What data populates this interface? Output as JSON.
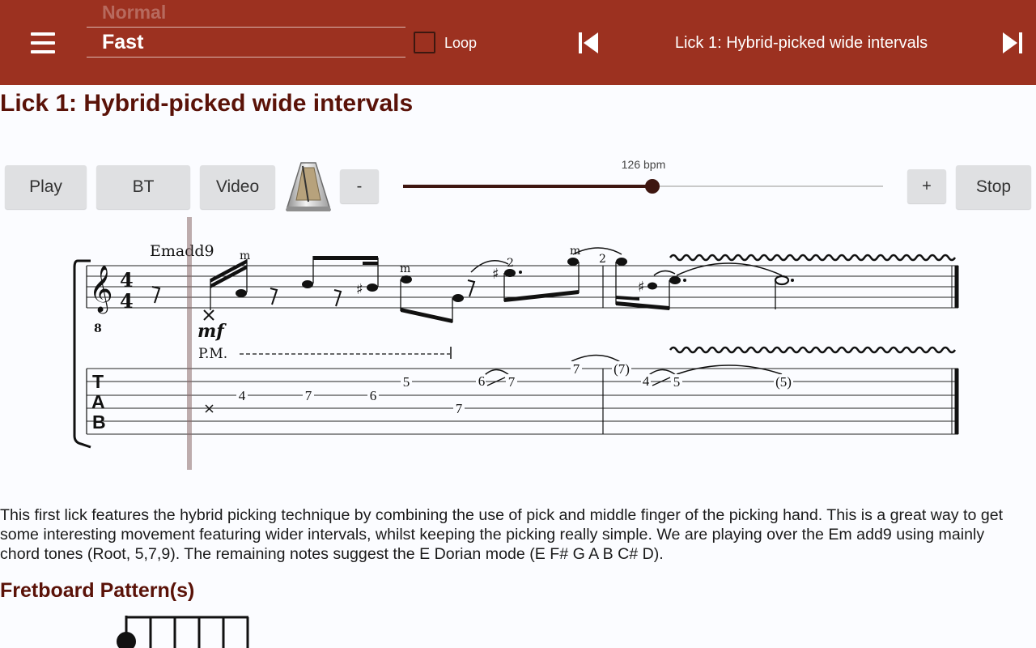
{
  "header": {
    "speed_prev": "Normal",
    "speed_current": "Fast",
    "loop_label": "Loop",
    "loop_checked": false,
    "title": "Lick 1: Hybrid-picked wide intervals",
    "icons": {
      "menu": "hamburger-menu-icon",
      "prev": "skip-previous-icon",
      "next": "skip-next-icon"
    },
    "colors": {
      "bar_bg": "#9c3120",
      "heading": "#5a1208"
    }
  },
  "page": {
    "title": "Lick 1: Hybrid-picked wide intervals"
  },
  "controls": {
    "play": "Play",
    "bt": "BT",
    "video": "Video",
    "minus": "-",
    "plus": "+",
    "stop": "Stop",
    "metronome_icon": "metronome-icon",
    "tempo": {
      "label": "126 bpm",
      "value": 126,
      "fraction": 0.52
    }
  },
  "notation": {
    "chord": "Emadd9",
    "time_signature": "4/4",
    "clef_octave": "8",
    "dynamic": "mf",
    "palm_mute": "P.M.",
    "finger_marks": [
      "m",
      "m",
      "m"
    ],
    "fingering": [
      "2",
      "2"
    ],
    "tab_letters": [
      "T",
      "A",
      "B"
    ],
    "tab_numbers": [
      "4",
      "7",
      "6",
      "5",
      "7",
      "6",
      "7",
      "7",
      "(7)",
      "4",
      "5",
      "(5)"
    ]
  },
  "description": "This first lick features the hybrid picking technique by combining the use of pick and middle finger of the picking hand. This is a great way to get some interesting movement featuring wider intervals, whilst keeping the picking really simple. We are playing over the Em add9 using mainly chord tones (Root, 5,7,9). The remaining notes suggest the E Dorian mode (E F# G A B C# D).",
  "fretboard": {
    "title": "Fretboard Pattern(s)"
  }
}
